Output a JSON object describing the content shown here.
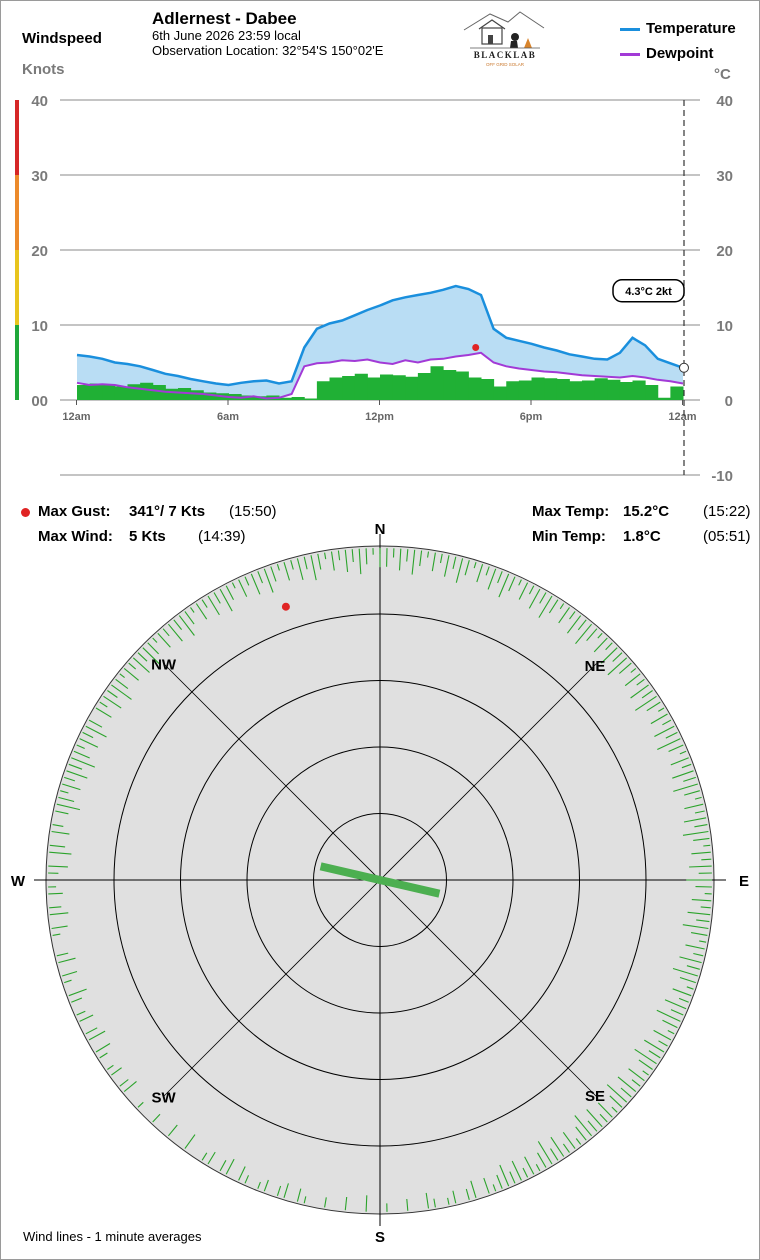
{
  "header": {
    "title": "Adlernest - Dabee",
    "datetime": "6th June 2026  23:59 local",
    "location": "Observation Location: 32°54'S 150°02'E",
    "logo_text": "BLACKLAB",
    "logo_subtext": "OFF GRID SOLAR"
  },
  "left_axis": {
    "title": "Windspeed",
    "unit": "Knots"
  },
  "right_axis": {
    "unit": "°C"
  },
  "legend": [
    {
      "label": "Temperature",
      "color": "#1a8fdd"
    },
    {
      "label": "Dewpoint",
      "color": "#a23ad6"
    }
  ],
  "stats": {
    "max_gust_label": "Max Gust:",
    "max_gust_value": "341°/ 7 Kts",
    "max_gust_time": "(15:50)",
    "max_wind_label": "Max Wind:",
    "max_wind_value": "5 Kts",
    "max_wind_time": "(14:39)",
    "max_temp_label": "Max Temp:",
    "max_temp_value": "15.2°C",
    "max_temp_time": "(15:22)",
    "min_temp_label": "Min Temp:",
    "min_temp_value": "1.8°C",
    "min_temp_time": "(05:51)"
  },
  "footnote": "Wind lines - 1 minute averages",
  "chart_data": {
    "type": "line",
    "x_unit": "hours",
    "x_ticks": [
      {
        "label": "12am",
        "value": 0
      },
      {
        "label": "6am",
        "value": 6
      },
      {
        "label": "12pm",
        "value": 12
      },
      {
        "label": "6pm",
        "value": 18
      },
      {
        "label": "12am",
        "value": 24
      }
    ],
    "xlim": [
      0,
      24
    ],
    "left_ylim": [
      0,
      40
    ],
    "left_yticks": [
      {
        "label": "40",
        "value": 40
      },
      {
        "label": "30",
        "value": 30
      },
      {
        "label": "20",
        "value": 20
      },
      {
        "label": "10",
        "value": 10
      },
      {
        "label": "00",
        "value": 0
      }
    ],
    "right_ylim": [
      -10,
      40
    ],
    "right_yticks": [
      40,
      30,
      20,
      10,
      0,
      -10
    ],
    "wind_scale_colors": [
      {
        "from": 0,
        "to": 10,
        "color": "#1fa83a"
      },
      {
        "from": 10,
        "to": 20,
        "color": "#e8c51e"
      },
      {
        "from": 20,
        "to": 30,
        "color": "#ec8a2b"
      },
      {
        "from": 30,
        "to": 40,
        "color": "#d62727"
      }
    ],
    "series": [
      {
        "name": "Temperature",
        "color": "#1a8fdd",
        "fill": "#b9ddf4",
        "x": [
          0,
          0.5,
          1,
          1.5,
          2,
          2.5,
          3,
          3.5,
          4,
          4.5,
          5,
          5.5,
          6,
          6.5,
          7,
          7.5,
          8,
          8.5,
          9,
          9.5,
          10,
          10.5,
          11,
          11.5,
          12,
          12.5,
          13,
          13.5,
          14,
          14.5,
          15,
          15.5,
          16,
          16.5,
          17,
          17.5,
          18,
          18.5,
          19,
          19.5,
          20,
          20.5,
          21,
          21.5,
          22,
          22.5,
          23,
          23.5,
          24
        ],
        "values": [
          6.0,
          5.8,
          5.5,
          5.0,
          4.8,
          4.5,
          4.0,
          3.5,
          3.2,
          2.8,
          2.5,
          2.2,
          2.0,
          2.3,
          2.5,
          2.6,
          2.2,
          2.5,
          7.0,
          9.5,
          10.2,
          10.6,
          11.3,
          12.0,
          12.6,
          13.3,
          13.7,
          14.0,
          14.3,
          14.7,
          15.2,
          14.8,
          14.0,
          9.5,
          8.3,
          7.9,
          7.5,
          7.0,
          6.6,
          6.1,
          5.8,
          5.5,
          5.4,
          6.3,
          8.3,
          7.3,
          5.5,
          4.9,
          4.3
        ]
      },
      {
        "name": "Dewpoint",
        "color": "#a23ad6",
        "x": [
          0,
          0.5,
          1,
          1.5,
          2,
          2.5,
          3,
          3.5,
          4,
          4.5,
          5,
          5.5,
          6,
          6.5,
          7,
          7.5,
          8,
          8.5,
          9,
          9.5,
          10,
          10.5,
          11,
          11.5,
          12,
          12.5,
          13,
          13.5,
          14,
          14.5,
          15,
          15.5,
          16,
          16.5,
          17,
          17.5,
          18,
          18.5,
          19,
          19.5,
          20,
          20.5,
          21,
          21.5,
          22,
          22.5,
          23,
          23.5,
          24
        ],
        "values": [
          2.3,
          2.0,
          2.1,
          2.0,
          1.7,
          1.5,
          1.3,
          1.1,
          1.0,
          0.9,
          0.8,
          0.6,
          0.4,
          0.3,
          0.5,
          0.2,
          0.3,
          0.8,
          4.5,
          4.9,
          5.0,
          5.3,
          5.2,
          5.4,
          5.0,
          4.8,
          5.3,
          5.0,
          5.4,
          5.5,
          5.8,
          6.0,
          6.3,
          5.0,
          4.5,
          4.2,
          4.0,
          3.8,
          3.7,
          3.5,
          3.3,
          3.2,
          3.1,
          3.0,
          3.2,
          3.0,
          2.7,
          2.5,
          2.2
        ]
      },
      {
        "name": "Wind",
        "color": "#20b035",
        "x": [
          0,
          0.5,
          1,
          1.5,
          2,
          2.5,
          3,
          3.5,
          4,
          4.5,
          5,
          5.5,
          6,
          6.5,
          7,
          7.5,
          8,
          8.5,
          9,
          9.5,
          10,
          10.5,
          11,
          11.5,
          12,
          12.5,
          13,
          13.5,
          14,
          14.5,
          15,
          15.5,
          16,
          16.5,
          17,
          17.5,
          18,
          18.5,
          19,
          19.5,
          20,
          20.5,
          21,
          21.5,
          22,
          22.5,
          23,
          23.5,
          24
        ],
        "values": [
          2.0,
          2.2,
          2.0,
          1.8,
          2.1,
          2.3,
          2.0,
          1.5,
          1.6,
          1.3,
          1.0,
          0.9,
          0.8,
          0.6,
          0.5,
          0.6,
          0.3,
          0.4,
          0.2,
          2.5,
          3.0,
          3.2,
          3.5,
          3.0,
          3.4,
          3.3,
          3.1,
          3.6,
          4.5,
          4.0,
          3.8,
          3.0,
          2.8,
          1.8,
          2.5,
          2.6,
          3.0,
          2.9,
          2.8,
          2.5,
          2.6,
          2.9,
          2.7,
          2.4,
          2.6,
          2.0,
          0.3,
          1.8,
          1.2
        ]
      }
    ],
    "max_gust_marker": {
      "x": 15.83,
      "value": 7
    },
    "cursor": {
      "x": 24,
      "label": "4.3°C  2kt"
    },
    "wind_rose": {
      "type": "polar",
      "directions": [
        "N",
        "NE",
        "E",
        "SE",
        "S",
        "SW",
        "W",
        "NW"
      ],
      "rings": 5,
      "current_wind_direction_deg": 103,
      "current_wind_speed_kts": 2,
      "max_gust_direction_deg": 341,
      "max_gust_speed_kts": 7
    }
  }
}
